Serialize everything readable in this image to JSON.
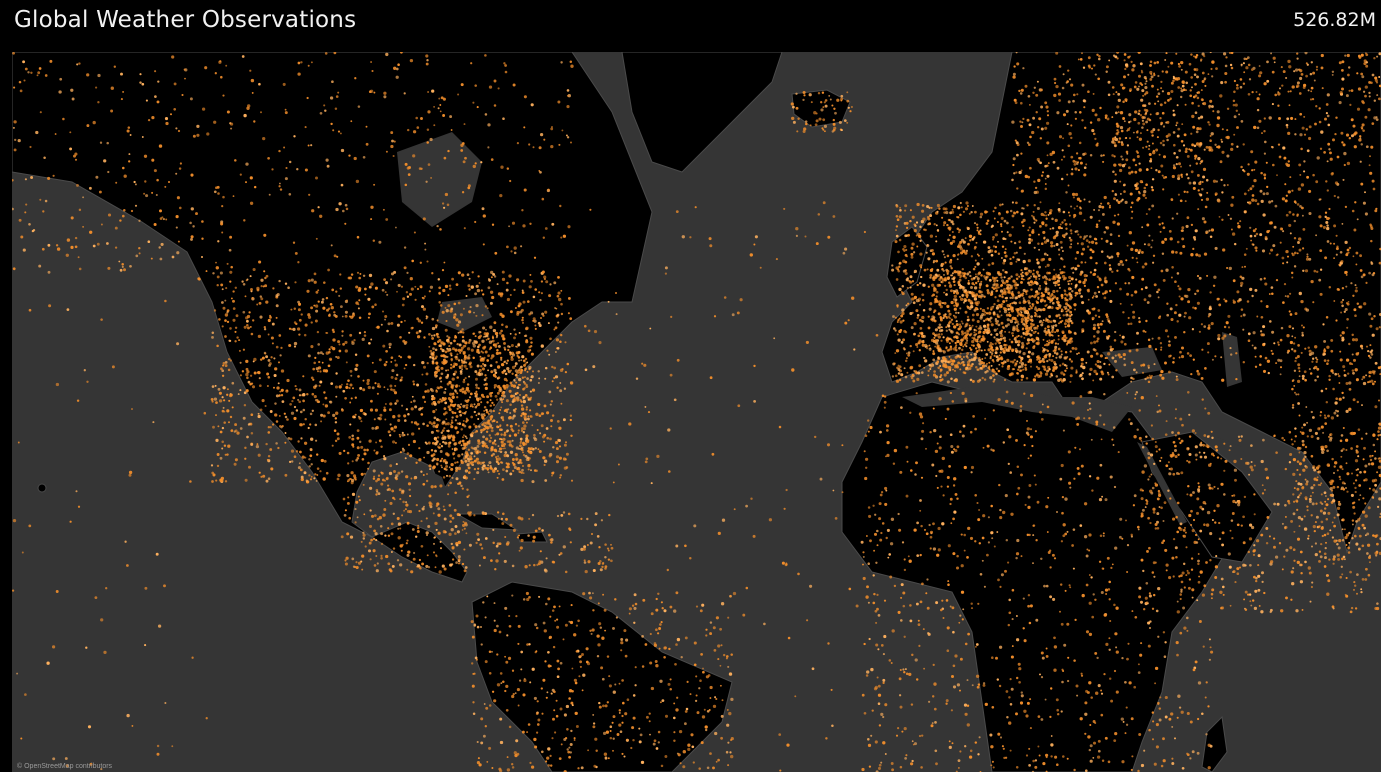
{
  "header": {
    "title": "Global Weather Observations",
    "total_value": "526.82M"
  },
  "map": {
    "attribution": "© OpenStreetMap contributors",
    "colors": {
      "ocean": "#353535",
      "land": "#000000",
      "border": "#4a4a4a",
      "dot": "#f28e2b",
      "dot_bright": "#ffb15e"
    }
  }
}
